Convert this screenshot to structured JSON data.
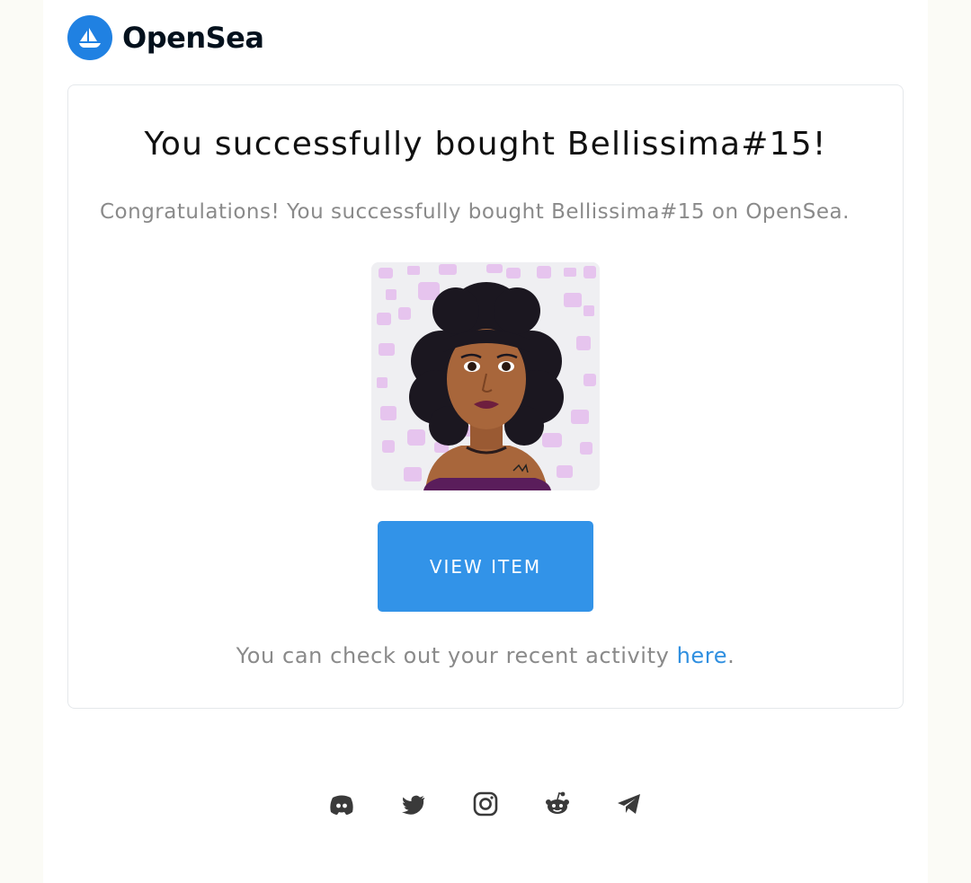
{
  "brand": {
    "name": "OpenSea",
    "logo_icon": "opensea-sailboat-icon",
    "color": "#2081e2"
  },
  "email": {
    "title": "You successfully bought Bellissima#15!",
    "congrats": "Congratulations! You successfully bought Bellissima#15 on OpenSea.",
    "nft_image": "portrait-illustration",
    "cta_label": "VIEW ITEM",
    "cta_color": "#3293e8",
    "activity_prefix": "You can check out your recent activity ",
    "activity_link": "here",
    "activity_suffix": "."
  },
  "footer": {
    "socials": [
      "discord-icon",
      "twitter-icon",
      "instagram-icon",
      "reddit-icon",
      "telegram-icon"
    ]
  }
}
